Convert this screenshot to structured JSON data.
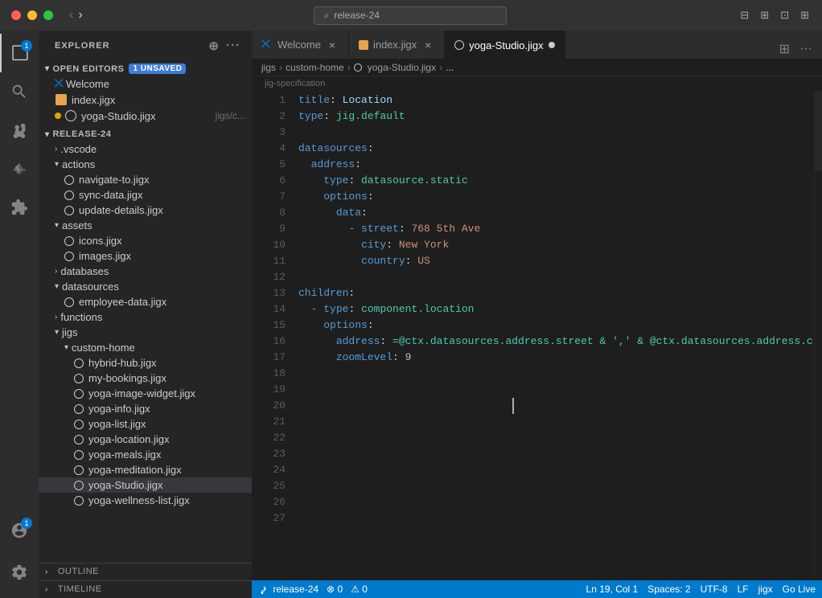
{
  "titlebar": {
    "search_text": "release-24",
    "nav_back_label": "◀",
    "nav_fwd_label": "▶"
  },
  "sidebar": {
    "title": "Explorer",
    "open_editors_label": "Open Editors",
    "unsaved_badge": "1 unsaved",
    "open_files": [
      {
        "name": "Welcome",
        "icon_type": "vscode",
        "modified": false
      },
      {
        "name": "index.jigx",
        "icon_type": "orange",
        "modified": false
      },
      {
        "name": "yoga-Studio.jigx",
        "icon_type": "dot",
        "modified": true,
        "path": "jigs/c..."
      }
    ],
    "release_section": "RELEASE-24",
    "tree": [
      {
        "type": "folder",
        "name": ".vscode",
        "depth": 1,
        "open": false
      },
      {
        "type": "folder",
        "name": "actions",
        "depth": 1,
        "open": true
      },
      {
        "type": "file",
        "name": "navigate-to.jigx",
        "depth": 2,
        "icon": "dot"
      },
      {
        "type": "file",
        "name": "sync-data.jigx",
        "depth": 2,
        "icon": "dot"
      },
      {
        "type": "file",
        "name": "update-details.jigx",
        "depth": 2,
        "icon": "dot"
      },
      {
        "type": "folder",
        "name": "assets",
        "depth": 1,
        "open": true
      },
      {
        "type": "file",
        "name": "icons.jigx",
        "depth": 2,
        "icon": "dot"
      },
      {
        "type": "file",
        "name": "images.jigx",
        "depth": 2,
        "icon": "dot"
      },
      {
        "type": "folder",
        "name": "databases",
        "depth": 1,
        "open": false
      },
      {
        "type": "folder",
        "name": "datasources",
        "depth": 1,
        "open": true
      },
      {
        "type": "file",
        "name": "employee-data.jigx",
        "depth": 2,
        "icon": "dot"
      },
      {
        "type": "folder",
        "name": "functions",
        "depth": 1,
        "open": false
      },
      {
        "type": "folder",
        "name": "jigs",
        "depth": 1,
        "open": true
      },
      {
        "type": "folder",
        "name": "custom-home",
        "depth": 2,
        "open": true
      },
      {
        "type": "file",
        "name": "hybrid-hub.jigx",
        "depth": 3,
        "icon": "dot"
      },
      {
        "type": "file",
        "name": "my-bookings.jigx",
        "depth": 3,
        "icon": "dot"
      },
      {
        "type": "file",
        "name": "yoga-image-widget.jigx",
        "depth": 3,
        "icon": "dot"
      },
      {
        "type": "file",
        "name": "yoga-info.jigx",
        "depth": 3,
        "icon": "dot"
      },
      {
        "type": "file",
        "name": "yoga-list.jigx",
        "depth": 3,
        "icon": "dot"
      },
      {
        "type": "file",
        "name": "yoga-location.jigx",
        "depth": 3,
        "icon": "dot"
      },
      {
        "type": "file",
        "name": "yoga-meals.jigx",
        "depth": 3,
        "icon": "dot"
      },
      {
        "type": "file",
        "name": "yoga-meditation.jigx",
        "depth": 3,
        "icon": "dot"
      },
      {
        "type": "file",
        "name": "yoga-Studio.jigx",
        "depth": 3,
        "icon": "dot",
        "active": true
      },
      {
        "type": "file",
        "name": "yoga-wellness-list.jigx",
        "depth": 3,
        "icon": "dot"
      }
    ],
    "outline_label": "OUTLINE",
    "timeline_label": "TIMELINE"
  },
  "tabs": [
    {
      "id": "welcome",
      "label": "Welcome",
      "icon": "vscode",
      "active": false,
      "modified": false
    },
    {
      "id": "index",
      "label": "index.jigx",
      "icon": "orange",
      "active": false,
      "modified": false
    },
    {
      "id": "yoga-studio",
      "label": "yoga-Studio.jigx",
      "icon": "dot",
      "active": true,
      "modified": true
    }
  ],
  "breadcrumb": {
    "parts": [
      "jigs",
      "custom-home",
      "yoga-Studio.jigx",
      "..."
    ]
  },
  "sub_breadcrumb": "jig-specification",
  "editor": {
    "lines": [
      {
        "num": 1,
        "content": [
          {
            "t": "k",
            "v": "title"
          },
          {
            "t": "op",
            "v": ": "
          },
          {
            "t": "n",
            "v": "Location"
          }
        ]
      },
      {
        "num": 2,
        "content": [
          {
            "t": "k",
            "v": "type"
          },
          {
            "t": "op",
            "v": ": "
          },
          {
            "t": "c",
            "v": "jig.default"
          }
        ]
      },
      {
        "num": 3,
        "content": []
      },
      {
        "num": 4,
        "content": [
          {
            "t": "k",
            "v": "datasources"
          },
          {
            "t": "op",
            "v": ":"
          }
        ]
      },
      {
        "num": 5,
        "content": [
          {
            "t": "",
            "v": "  "
          },
          {
            "t": "k",
            "v": "address"
          },
          {
            "t": "op",
            "v": ":"
          }
        ]
      },
      {
        "num": 6,
        "content": [
          {
            "t": "",
            "v": "    "
          },
          {
            "t": "k",
            "v": "type"
          },
          {
            "t": "op",
            "v": ": "
          },
          {
            "t": "c",
            "v": "datasource.static"
          }
        ]
      },
      {
        "num": 7,
        "content": [
          {
            "t": "",
            "v": "    "
          },
          {
            "t": "k",
            "v": "options"
          },
          {
            "t": "op",
            "v": ":"
          }
        ]
      },
      {
        "num": 8,
        "content": [
          {
            "t": "",
            "v": "      "
          },
          {
            "t": "k",
            "v": "data"
          },
          {
            "t": "op",
            "v": ":"
          }
        ]
      },
      {
        "num": 9,
        "content": [
          {
            "t": "",
            "v": "        "
          },
          {
            "t": "dash",
            "v": "- "
          },
          {
            "t": "k",
            "v": "street"
          },
          {
            "t": "op",
            "v": ": "
          },
          {
            "t": "s",
            "v": "768 5th Ave"
          }
        ]
      },
      {
        "num": 10,
        "content": [
          {
            "t": "",
            "v": "          "
          },
          {
            "t": "k",
            "v": "city"
          },
          {
            "t": "op",
            "v": ": "
          },
          {
            "t": "s",
            "v": "New York"
          }
        ]
      },
      {
        "num": 11,
        "content": [
          {
            "t": "",
            "v": "          "
          },
          {
            "t": "k",
            "v": "country"
          },
          {
            "t": "op",
            "v": ": "
          },
          {
            "t": "s",
            "v": "US"
          }
        ]
      },
      {
        "num": 12,
        "content": []
      },
      {
        "num": 13,
        "content": [
          {
            "t": "k",
            "v": "children"
          },
          {
            "t": "op",
            "v": ":"
          }
        ]
      },
      {
        "num": 14,
        "content": [
          {
            "t": "",
            "v": "  "
          },
          {
            "t": "dash",
            "v": "- "
          },
          {
            "t": "k",
            "v": "type"
          },
          {
            "t": "op",
            "v": ": "
          },
          {
            "t": "c",
            "v": "component.location"
          }
        ]
      },
      {
        "num": 15,
        "content": [
          {
            "t": "",
            "v": "    "
          },
          {
            "t": "k",
            "v": "options"
          },
          {
            "t": "op",
            "v": ":"
          }
        ]
      },
      {
        "num": 16,
        "content": [
          {
            "t": "",
            "v": "      "
          },
          {
            "t": "k",
            "v": "address"
          },
          {
            "t": "op",
            "v": ": "
          },
          {
            "t": "at",
            "v": "=@ctx.datasources.address.street & ',' & @ctx.datasources.address.c"
          }
        ]
      },
      {
        "num": 17,
        "content": [
          {
            "t": "",
            "v": "      "
          },
          {
            "t": "k",
            "v": "zoomLevel"
          },
          {
            "t": "op",
            "v": ": "
          },
          {
            "t": "num",
            "v": "9"
          }
        ]
      },
      {
        "num": 18,
        "content": []
      },
      {
        "num": 19,
        "content": []
      },
      {
        "num": 20,
        "content": []
      },
      {
        "num": 21,
        "content": []
      },
      {
        "num": 22,
        "content": []
      },
      {
        "num": 23,
        "content": []
      },
      {
        "num": 24,
        "content": []
      },
      {
        "num": 25,
        "content": []
      },
      {
        "num": 26,
        "content": []
      },
      {
        "num": 27,
        "content": []
      }
    ]
  },
  "statusbar": {
    "branch": "release-24",
    "errors": "0",
    "warnings": "0",
    "ln": "Ln 19",
    "col": "Col 1",
    "spaces": "Spaces: 2",
    "encoding": "UTF-8",
    "eol": "LF",
    "lang": "jigx",
    "feedback": "Go Live"
  },
  "bottom_panels": [
    "OUTLINE",
    "TIMELINE"
  ]
}
